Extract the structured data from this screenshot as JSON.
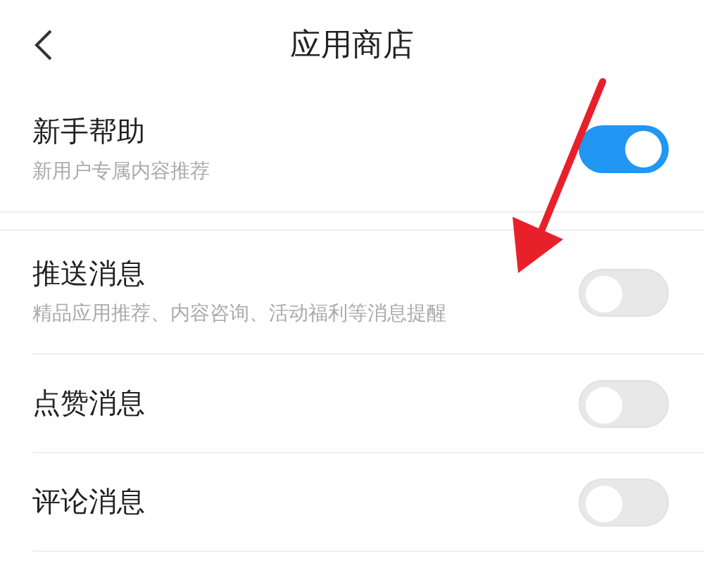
{
  "header": {
    "title": "应用商店"
  },
  "groups": [
    {
      "items": [
        {
          "title": "新手帮助",
          "subtitle": "新用户专属内容推荐",
          "on": true
        }
      ]
    },
    {
      "items": [
        {
          "title": "推送消息",
          "subtitle": "精品应用推荐、内容咨询、活动福利等消息提醒",
          "on": false
        },
        {
          "title": "点赞消息",
          "on": false
        },
        {
          "title": "评论消息",
          "on": false
        }
      ]
    }
  ]
}
